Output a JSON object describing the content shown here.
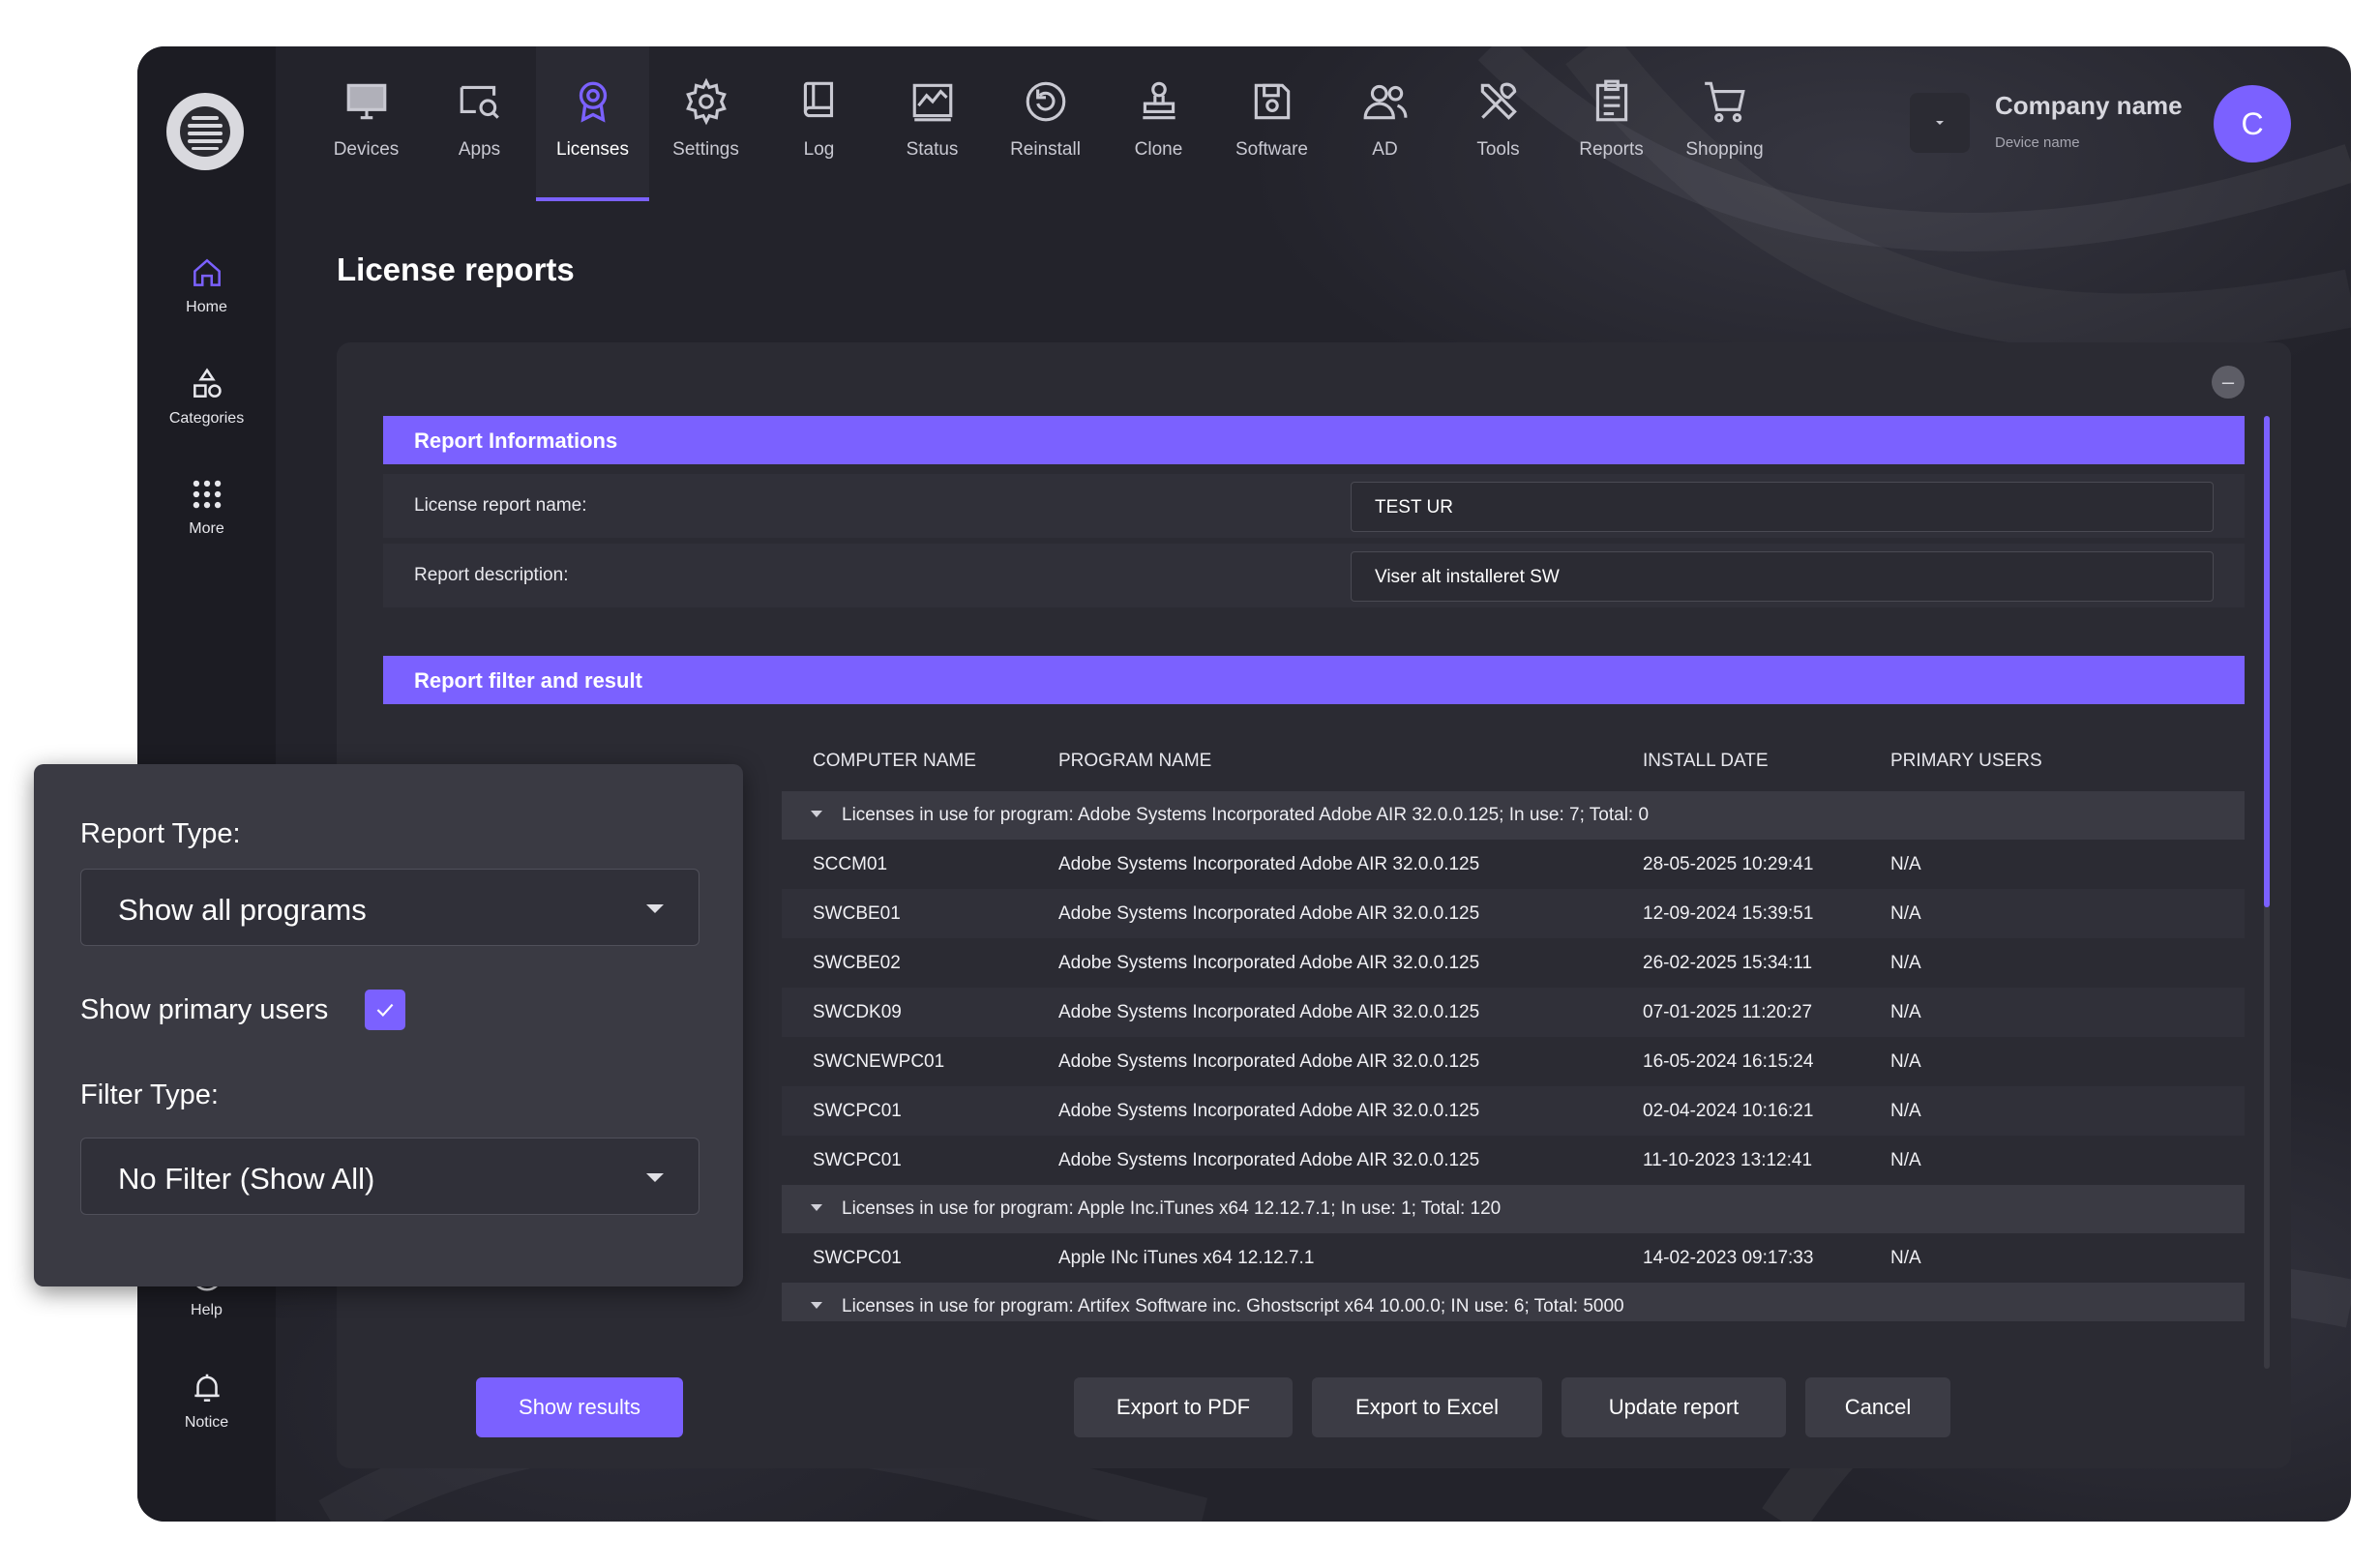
{
  "colors": {
    "accent": "#7b61ff",
    "background": "#23232b",
    "sidebar": "#1c1c23",
    "card": "#2b2b33",
    "panel": "#3a3a43"
  },
  "sidebar": {
    "logo_icon": "brand-logo-icon",
    "top_items": [
      {
        "label": "Home",
        "icon": "home-icon"
      },
      {
        "label": "Categories",
        "icon": "categories-icon"
      },
      {
        "label": "More",
        "icon": "grid-dots-icon"
      }
    ],
    "bottom_items": [
      {
        "label": "Help",
        "icon": "help-icon"
      },
      {
        "label": "Notice",
        "icon": "bell-icon"
      }
    ]
  },
  "topnav": {
    "items": [
      {
        "label": "Devices",
        "icon": "monitor-icon"
      },
      {
        "label": "Apps",
        "icon": "apps-search-icon"
      },
      {
        "label": "Licenses",
        "icon": "award-badge-icon",
        "active": true
      },
      {
        "label": "Settings",
        "icon": "gear-icon"
      },
      {
        "label": "Log",
        "icon": "book-icon"
      },
      {
        "label": "Status",
        "icon": "chart-icon"
      },
      {
        "label": "Reinstall",
        "icon": "reinstall-icon"
      },
      {
        "label": "Clone",
        "icon": "stamp-icon"
      },
      {
        "label": "Software",
        "icon": "floppy-icon"
      },
      {
        "label": "AD",
        "icon": "users-icon"
      },
      {
        "label": "Tools",
        "icon": "tools-icon"
      },
      {
        "label": "Reports",
        "icon": "clipboard-icon"
      },
      {
        "label": "Shopping",
        "icon": "cart-icon"
      }
    ]
  },
  "account": {
    "company_name": "Company name",
    "device_name": "Device name",
    "avatar_initial": "C"
  },
  "page": {
    "title": "License reports"
  },
  "report_info": {
    "header": "Report Informations",
    "name_label": "License report name:",
    "name_value": "TEST UR",
    "description_label": "Report description:",
    "description_value": "Viser alt installeret SW"
  },
  "report_filter": {
    "header": "Report filter and result",
    "columns": [
      "COMPUTER NAME",
      "PROGRAM NAME",
      "INSTALL DATE",
      "PRIMARY USERS"
    ],
    "groups": [
      {
        "title": "Licenses in use for program: Adobe Systems Incorporated Adobe AIR 32.0.0.125; In use: 7; Total: 0",
        "rows": [
          [
            "SCCM01",
            "Adobe Systems Incorporated Adobe AIR 32.0.0.125",
            "28-05-2025 10:29:41",
            "N/A"
          ],
          [
            "SWCBE01",
            "Adobe Systems Incorporated Adobe AIR 32.0.0.125",
            "12-09-2024 15:39:51",
            "N/A"
          ],
          [
            "SWCBE02",
            "Adobe Systems Incorporated Adobe AIR 32.0.0.125",
            "26-02-2025 15:34:11",
            "N/A"
          ],
          [
            "SWCDK09",
            "Adobe Systems Incorporated Adobe AIR 32.0.0.125",
            "07-01-2025 11:20:27",
            "N/A"
          ],
          [
            "SWCNEWPC01",
            "Adobe Systems Incorporated Adobe AIR 32.0.0.125",
            "16-05-2024 16:15:24",
            "N/A"
          ],
          [
            "SWCPC01",
            "Adobe Systems Incorporated Adobe AIR 32.0.0.125",
            "02-04-2024 10:16:21",
            "N/A"
          ],
          [
            "SWCPC01",
            "Adobe Systems Incorporated Adobe AIR 32.0.0.125",
            "11-10-2023 13:12:41",
            "N/A"
          ]
        ]
      },
      {
        "title": "Licenses in use for program: Apple Inc.iTunes x64 12.12.7.1; In use: 1; Total: 120",
        "rows": [
          [
            "SWCPC01",
            "Apple INc iTunes x64 12.12.7.1",
            "14-02-2023 09:17:33",
            "N/A"
          ]
        ]
      },
      {
        "title": "Licenses in use for program: Artifex Software inc. Ghostscript x64 10.00.0; IN use: 6; Total: 5000",
        "rows": []
      }
    ]
  },
  "filter_panel": {
    "report_type_label": "Report Type:",
    "report_type_value": "Show all programs",
    "show_primary_users_label": "Show primary users",
    "show_primary_users_checked": true,
    "filter_type_label": "Filter Type:",
    "filter_type_value": "No Filter (Show All)"
  },
  "actions": {
    "show_results": "Show results",
    "export_pdf": "Export to PDF",
    "export_excel": "Export to Excel",
    "update_report": "Update report",
    "cancel": "Cancel"
  },
  "collapse_symbol": "–"
}
